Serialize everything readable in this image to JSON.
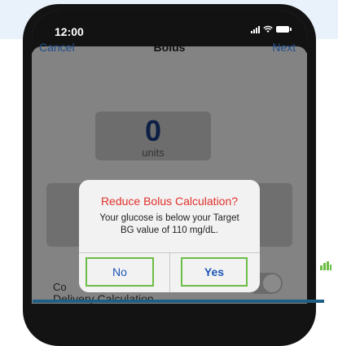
{
  "status": {
    "time": "12:00"
  },
  "nav": {
    "cancel": "Cancel",
    "title": "Bolus",
    "next": "Next"
  },
  "bolus": {
    "units_value": "0",
    "units_label": "units"
  },
  "form": {
    "row_label_partial": "Co",
    "delivery_label": "Delivery Calculation"
  },
  "alert": {
    "title": "Reduce Bolus Calculation?",
    "message": "Your glucose is below your Target BG value of 110 mg/dL.",
    "no_label": "No",
    "yes_label": "Yes"
  },
  "colors": {
    "accent_green": "#6cbd45",
    "alert_title_red": "#e0302a",
    "link_blue": "#1f4d8c",
    "button_blue": "#1d56b8",
    "rule_blue": "#1f5f86"
  },
  "icons": [
    "signal-icon",
    "wifi-icon",
    "battery-icon",
    "bar-chart-icon"
  ]
}
